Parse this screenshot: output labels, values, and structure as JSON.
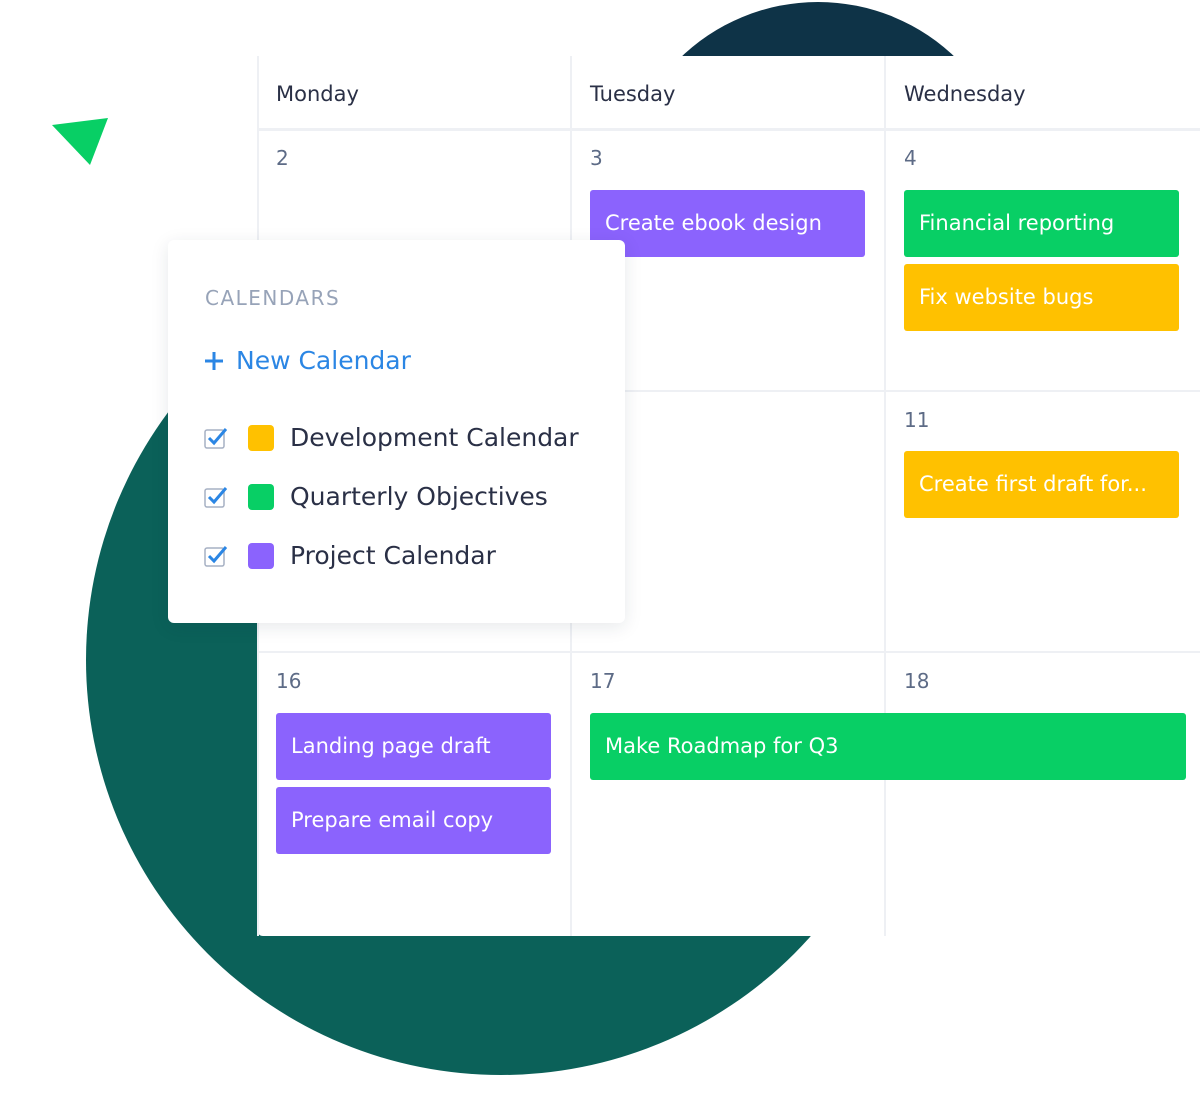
{
  "colors": {
    "purple": "#8b63fd",
    "green": "#08cf65",
    "yellow": "#ffc100",
    "teal": "#0b6159",
    "navy": "#0e3347",
    "accent": "#2b86e4"
  },
  "calendar": {
    "days": [
      "Monday",
      "Tuesday",
      "Wednesday"
    ],
    "dates": [
      "2",
      "3",
      "4",
      "11",
      "16",
      "17",
      "18"
    ],
    "events": [
      {
        "title": "Create ebook design",
        "color": "purple"
      },
      {
        "title": "Financial reporting",
        "color": "green"
      },
      {
        "title": "Fix website bugs",
        "color": "yellow"
      },
      {
        "title": "Create first draft for...",
        "color": "yellow"
      },
      {
        "title": "Landing page draft",
        "color": "purple"
      },
      {
        "title": "Prepare email copy",
        "color": "purple"
      },
      {
        "title": "Make Roadmap for Q3",
        "color": "green"
      }
    ]
  },
  "panel": {
    "title": "CALENDARS",
    "new_calendar": "New Calendar",
    "new_icon": "plus-icon",
    "items": [
      {
        "label": "Development Calendar",
        "color": "yellow",
        "checked": true
      },
      {
        "label": "Quarterly Objectives",
        "color": "green",
        "checked": true
      },
      {
        "label": "Project Calendar",
        "color": "purple",
        "checked": true
      }
    ]
  }
}
